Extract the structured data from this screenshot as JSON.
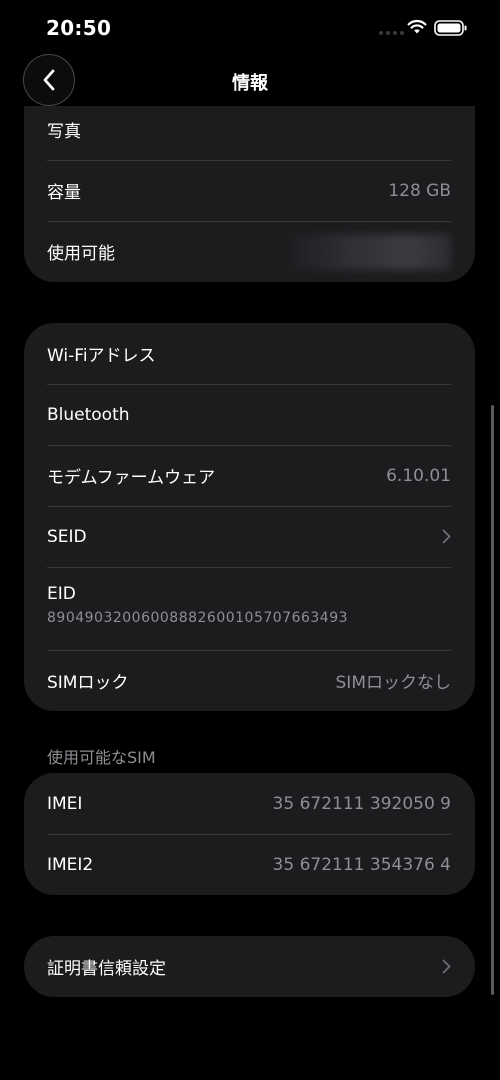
{
  "status_bar": {
    "time": "20:50"
  },
  "nav": {
    "title": "情報"
  },
  "storage_card": {
    "photos_label": "写真",
    "capacity_label": "容量",
    "capacity_value": "128 GB",
    "available_label": "使用可能"
  },
  "network_card": {
    "wifi_label": "Wi-Fiアドレス",
    "bluetooth_label": "Bluetooth",
    "modem_label": "モデムファームウェア",
    "modem_value": "6.10.01",
    "seid_label": "SEID",
    "eid_label": "EID",
    "eid_value": "89049032006008882600105707663493",
    "simlock_label": "SIMロック",
    "simlock_value": "SIMロックなし"
  },
  "sim_section": {
    "header": "使用可能なSIM",
    "imei_label": "IMEI",
    "imei_value": "35 672111 392050 9",
    "imei2_label": "IMEI2",
    "imei2_value": "35 672111 354376 4"
  },
  "cert_card": {
    "label": "証明書信頼設定"
  },
  "colors": {
    "background": "#000000",
    "card": "#1c1c1e",
    "separator": "#38383a",
    "secondary_text": "#8e8e93"
  }
}
